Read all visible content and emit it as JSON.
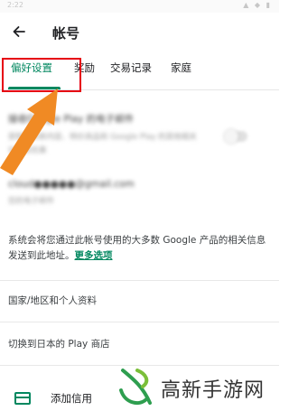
{
  "statusbar": {
    "time": "2:22",
    "icons": "▲ ◆ ▮"
  },
  "header": {
    "title": "帐号"
  },
  "tabs": [
    {
      "label": "偏好设置",
      "active": true
    },
    {
      "label": "奖励",
      "active": false
    },
    {
      "label": "交易记录",
      "active": false
    },
    {
      "label": "家庭",
      "active": false
    }
  ],
  "blurred": {
    "setting_title": "接收Google Play 的电子邮件",
    "setting_desc1": "获取有关新内容、特价商品和 Google Play 的其他相关",
    "setting_desc2": "信息和优惠",
    "email_value": "cloud●●●●●@gmail.com",
    "email_label": "您的电子邮件"
  },
  "info": {
    "text": "系统会将您通过此帐号使用的大多数 Google 产品的相关信息发送到此地址。",
    "link": "更多选项"
  },
  "list": {
    "country": "国家/地区和个人资料",
    "switch_store": "切换到日本的 Play 商店"
  },
  "bottom": {
    "add_label": "添加信用"
  },
  "watermark": {
    "text": "高新手游网"
  },
  "colors": {
    "accent": "#01875f",
    "highlight": "#e60012",
    "arrow": "#f08a24"
  }
}
